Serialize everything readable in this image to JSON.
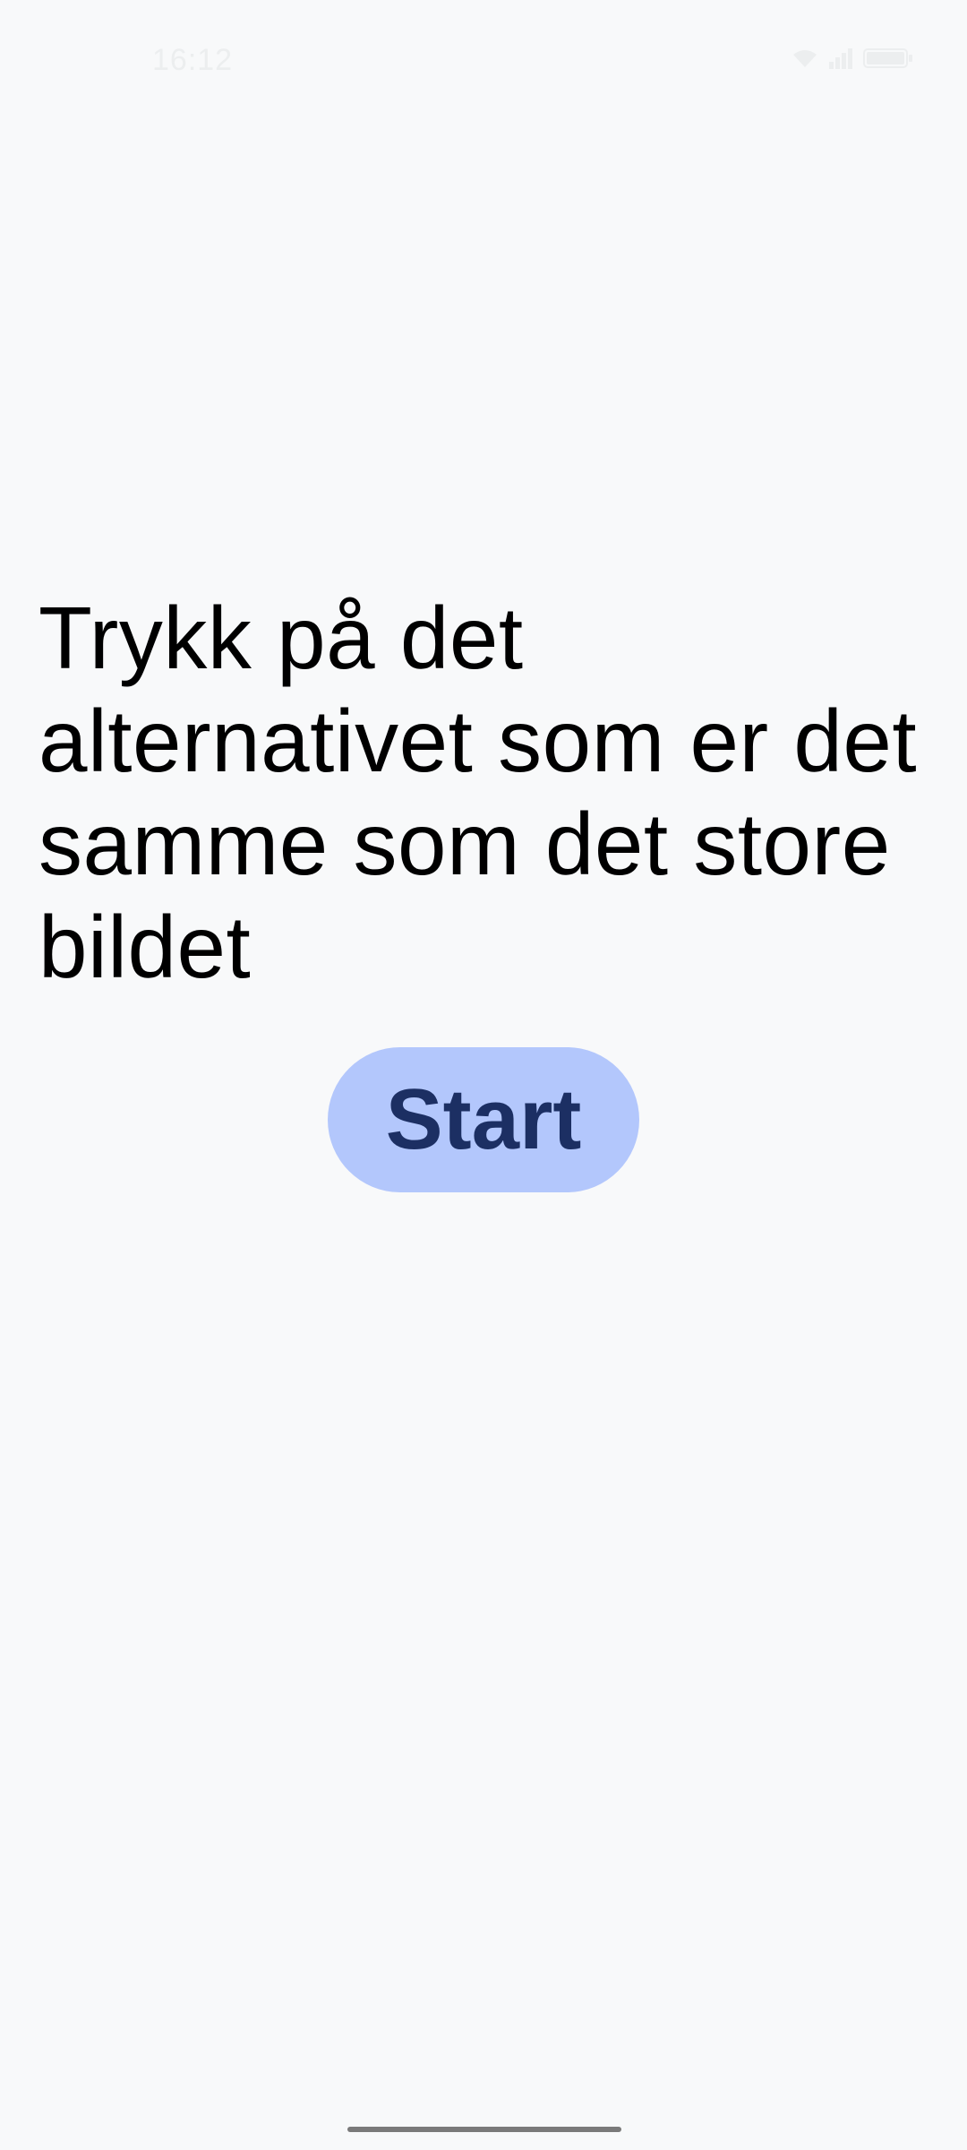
{
  "status_bar": {
    "time": "16:12",
    "icons": [
      "wifi-icon",
      "signal-icon",
      "battery-icon"
    ]
  },
  "main": {
    "instruction": "Trykk på det alternativet som er det samme som det store bildet",
    "start_button": "Start"
  },
  "colors": {
    "background": "#f8f9fa",
    "button_background": "#b3c7fc",
    "button_text": "#1c2f63",
    "text": "#000000"
  }
}
